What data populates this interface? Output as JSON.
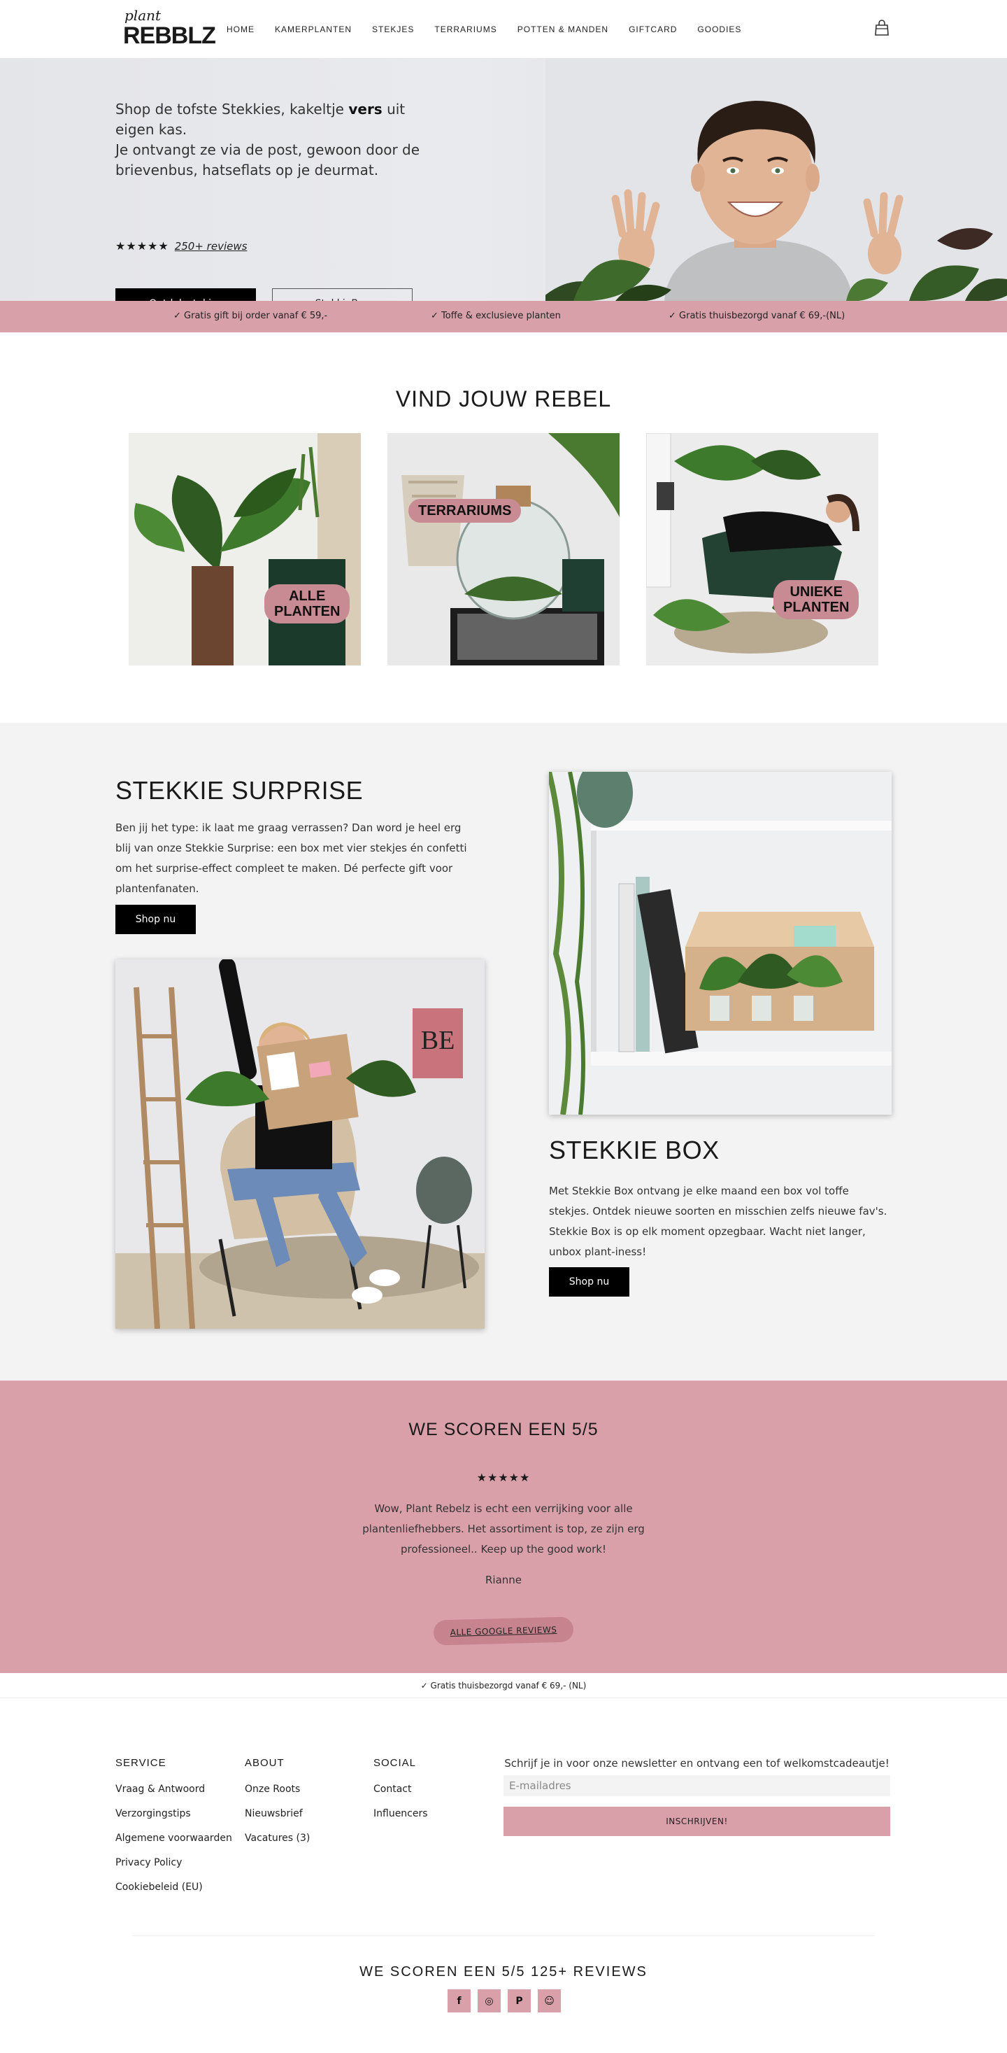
{
  "header": {
    "logo_small": "plant",
    "logo_big": "REBBLZ",
    "nav": [
      "HOME",
      "KAMERPLANTEN",
      "STEKJES",
      "TERRARIUMS",
      "POTTEN & MANDEN",
      "GIFTCARD",
      "GOODIES"
    ],
    "cart_icon": "shopping-bag-icon"
  },
  "hero": {
    "line1_pre": "Shop de tofste Stekkies, kakeltje ",
    "line1_bold": "vers",
    "line1_post": " uit eigen kas.",
    "line2": "Je ontvangt ze via de post, gewoon door de",
    "line3": "brievenbus, hatseflats op je deurmat.",
    "stars": "★★★★★",
    "reviews_link": "250+ reviews",
    "btn_primary": "Ontdek stekjes",
    "btn_secondary": "StekkieBox"
  },
  "usp": [
    "✓  Gratis gift bij order vanaf € 59,-",
    "✓  Toffe & exclusieve planten",
    "✓  Gratis thuisbezorgd vanaf € 69,-(NL)"
  ],
  "rebel": {
    "title": "VIND JOUW REBEL",
    "tiles": [
      {
        "label1": "ALLE",
        "label2": "PLANTEN"
      },
      {
        "label1": "TERRARIUMS",
        "label2": ""
      },
      {
        "label1": "UNIEKE",
        "label2": "PLANTEN"
      }
    ]
  },
  "surprise": {
    "title": "STEKKIE SURPRISE",
    "text": "Ben jij het type: ik laat me graag verrassen? Dan word je heel erg blij van onze Stekkie Surprise: een box met vier stekjes én confetti om het surprise-effect compleet te maken. Dé perfecte gift voor plantenfanaten.",
    "btn": "Shop nu",
    "poster_text": "BE"
  },
  "box": {
    "title": "STEKKIE BOX",
    "text": "Met Stekkie Box ontvang je elke maand een box vol toffe stekjes. Ontdek nieuwe soorten en misschien zelfs nieuwe fav's. Stekkie Box is op elk moment opzegbaar. Wacht niet langer, unbox plant-iness!",
    "btn": "Shop nu"
  },
  "reviews": {
    "title": "WE SCOREN EEN 5/5",
    "stars": "★★★★★",
    "quote": "Wow, Plant Rebelz is echt een verrijking voor alle plantenliefhebbers. Het assortiment is top, ze zijn erg professioneel.. Keep up the good work!",
    "author": "Rianne",
    "btn": "ALLE GOOGLE REVIEWS"
  },
  "freeship": "✓  Gratis thuisbezorgd vanaf € 69,- (NL)",
  "footer": {
    "service": {
      "title": "SERVICE",
      "links": [
        "Vraag & Antwoord",
        "Verzorgingstips",
        "Algemene voorwaarden",
        "Privacy Policy",
        "Cookiebeleid (EU)"
      ]
    },
    "about": {
      "title": "ABOUT",
      "links": [
        "Onze Roots",
        "Nieuwsbrief",
        "Vacatures (3)"
      ]
    },
    "social": {
      "title": "SOCIAL",
      "links": [
        "Contact",
        "Influencers"
      ]
    },
    "newsletter_text": "Schrijf je in voor onze newsletter en ontvang een tof welkomstcadeautje!",
    "email_placeholder": "E-mailadres",
    "subscribe": "INSCHRIJVEN!",
    "score": "WE SCOREN EEN 5/5 125+ REVIEWS",
    "socials": [
      "f",
      "◎",
      "P",
      "☺"
    ]
  },
  "colors": {
    "pink": "#d9a0aa",
    "pink_dark": "#c98b93",
    "black": "#000000",
    "section_grey": "#f3f3f3"
  }
}
